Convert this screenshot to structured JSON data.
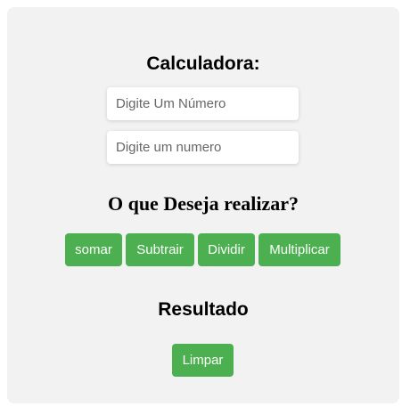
{
  "header": {
    "title": "Calculadora:"
  },
  "inputs": {
    "first": {
      "value": "",
      "placeholder": "Digite Um Número"
    },
    "second": {
      "value": "",
      "placeholder": "Digite um numero"
    }
  },
  "operations": {
    "question": "O que Deseja realizar?",
    "buttons": [
      "somar",
      "Subtrair",
      "Dividir",
      "Multiplicar"
    ]
  },
  "result": {
    "label": "Resultado",
    "clear_label": "Limpar"
  },
  "colors": {
    "accent": "#4caf50",
    "card_background": "#f2f2f2"
  }
}
